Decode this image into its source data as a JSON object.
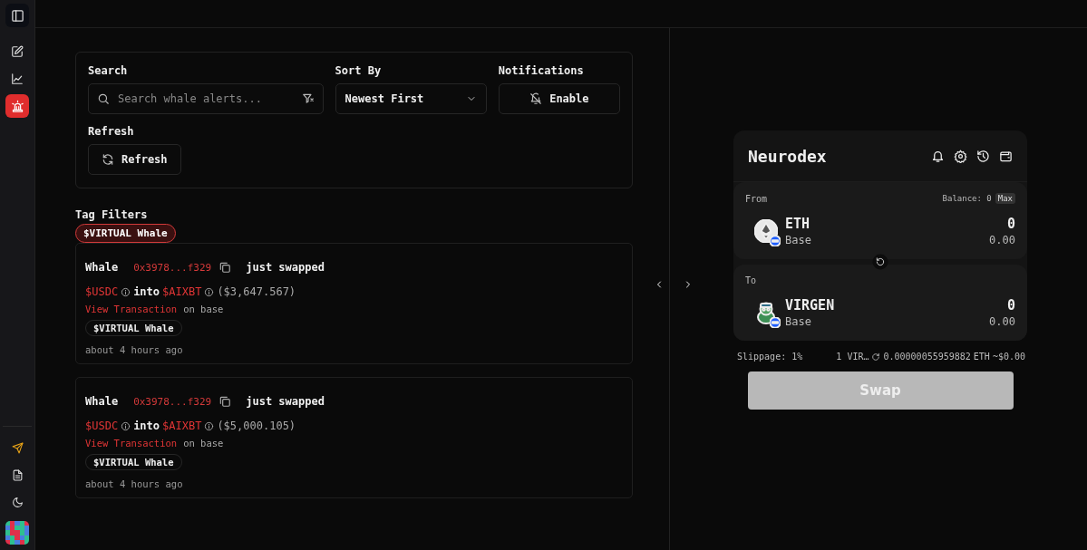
{
  "sidebar": {
    "items": [
      {
        "kind": "panel",
        "selected": false
      },
      {
        "kind": "edit",
        "selected": false
      },
      {
        "kind": "chart",
        "selected": false
      },
      {
        "kind": "alert",
        "selected": true
      }
    ],
    "bottom_items": [
      {
        "kind": "send",
        "selected": false
      },
      {
        "kind": "document",
        "selected": false
      },
      {
        "kind": "theme",
        "selected": false
      },
      {
        "kind": "avatar",
        "selected": false
      }
    ]
  },
  "filters": {
    "search": {
      "label": "Search",
      "placeholder": "Search whale alerts..."
    },
    "sort": {
      "label": "Sort By",
      "value": "Newest First"
    },
    "notifications": {
      "label": "Notifications",
      "button": "Enable"
    },
    "refresh": {
      "label": "Refresh",
      "button": "Refresh"
    }
  },
  "tag_filters": {
    "title": "Tag Filters",
    "tags": [
      {
        "label": "$VIRTUAL Whale",
        "selected": true
      }
    ]
  },
  "alerts": [
    {
      "actor": "Whale",
      "address": "0x3978...f329",
      "action": "just swapped",
      "from_token": "$USDC",
      "connector": "into",
      "to_token": "$AIXBT",
      "amount": "($3,647.567)",
      "link": "View Transaction",
      "network_text": "on base",
      "tag": "$VIRTUAL Whale",
      "time": "about 4 hours ago"
    },
    {
      "actor": "Whale",
      "address": "0x3978...f329",
      "action": "just swapped",
      "from_token": "$USDC",
      "connector": "into",
      "to_token": "$AIXBT",
      "amount": "($5,000.105)",
      "link": "View Transaction",
      "network_text": "on base",
      "tag": "$VIRTUAL Whale",
      "time": "about 4 hours ago"
    }
  ],
  "swap": {
    "title": "Neurodex",
    "from": {
      "label": "From",
      "balance": "Balance: 0",
      "max": "Max",
      "token": "ETH",
      "network": "Base",
      "amount": "0",
      "value": "0.00",
      "kind": "diamond"
    },
    "to": {
      "label": "To",
      "token": "VIRGEN",
      "network": "Base",
      "amount": "0",
      "value": "0.00",
      "kind": "frog"
    },
    "slippage": "Slippage: 1%",
    "rate": {
      "from": "1 VIR…",
      "value": "0.00000055959882",
      "unit": "ETH",
      "usd": "~$0.00"
    },
    "button": {
      "label": "Swap",
      "disabled": true
    }
  }
}
